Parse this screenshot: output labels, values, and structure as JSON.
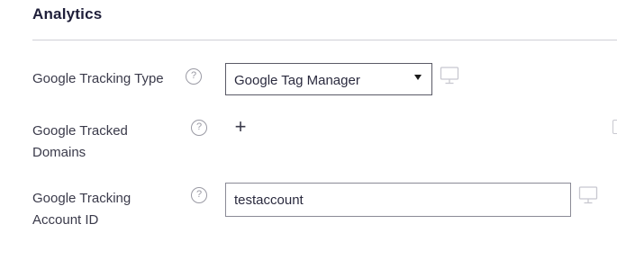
{
  "section": {
    "title": "Analytics"
  },
  "fields": {
    "tracking_type": {
      "label": "Google Tracking Type",
      "help": "?",
      "value": "Google Tag Manager"
    },
    "tracked_domains": {
      "label_line1": "Google Tracked",
      "label_line2": "Domains",
      "help": "?",
      "add": "+"
    },
    "account_id": {
      "label_line1": "Google Tracking",
      "label_line2": "Account ID",
      "help": "?",
      "value": "testaccount"
    }
  },
  "icons": {
    "help": "question-circle-icon",
    "device": "monitor-icon",
    "add": "plus-icon"
  }
}
